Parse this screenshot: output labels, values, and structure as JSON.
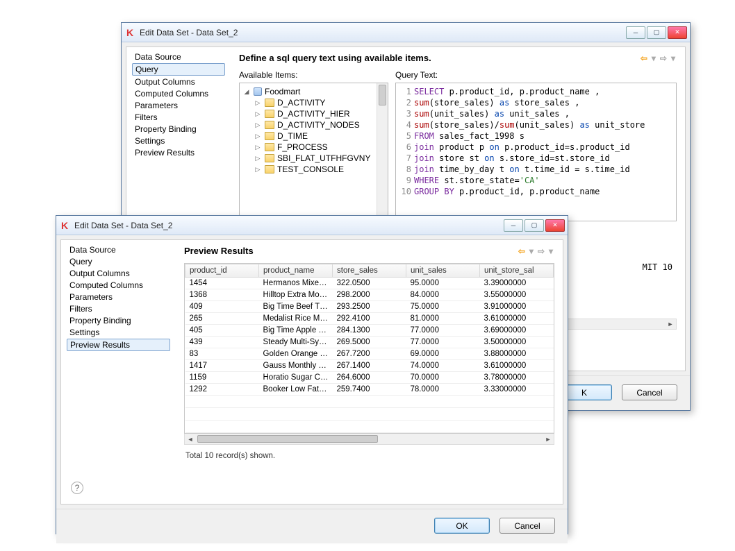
{
  "back": {
    "title": "Edit Data Set - Data Set_2",
    "nav": [
      "Data Source",
      "Query",
      "Output Columns",
      "Computed Columns",
      "Parameters",
      "Filters",
      "Property Binding",
      "Settings",
      "Preview Results"
    ],
    "nav_selected": 1,
    "heading": "Define a sql query text using available items.",
    "available_label": "Available Items:",
    "query_label": "Query Text:",
    "tree_root": "Foodmart",
    "tree_items": [
      "D_ACTIVITY",
      "D_ACTIVITY_HIER",
      "D_ACTIVITY_NODES",
      "D_TIME",
      "F_PROCESS",
      "SBI_FLAT_UTFHFGVNY",
      "TEST_CONSOLE"
    ],
    "sql_lines": [
      {
        "n": 1,
        "tokens": [
          [
            "kw-purple",
            "SELECT"
          ],
          [
            "",
            " p.product_id, p.product_name ,"
          ]
        ]
      },
      {
        "n": 2,
        "tokens": [
          [
            "kw-red",
            "sum"
          ],
          [
            "",
            "(store_sales) "
          ],
          [
            "kw-blue",
            "as"
          ],
          [
            "",
            " store_sales ,"
          ]
        ]
      },
      {
        "n": 3,
        "tokens": [
          [
            "kw-red",
            "sum"
          ],
          [
            "",
            "(unit_sales) "
          ],
          [
            "kw-blue",
            "as"
          ],
          [
            "",
            " unit_sales ,"
          ]
        ]
      },
      {
        "n": 4,
        "tokens": [
          [
            "kw-red",
            "sum"
          ],
          [
            "",
            "(store_sales)/"
          ],
          [
            "kw-red",
            "sum"
          ],
          [
            "",
            "(unit_sales) "
          ],
          [
            "kw-blue",
            "as"
          ],
          [
            "",
            " unit_store"
          ]
        ]
      },
      {
        "n": 5,
        "tokens": [
          [
            "kw-purple",
            "FROM"
          ],
          [
            "",
            " sales_fact_1998 s"
          ]
        ]
      },
      {
        "n": 6,
        "tokens": [
          [
            "kw-purple",
            "join"
          ],
          [
            "",
            " product p "
          ],
          [
            "kw-blue",
            "on"
          ],
          [
            "",
            " p.product_id=s.product_id"
          ]
        ]
      },
      {
        "n": 7,
        "tokens": [
          [
            "kw-purple",
            "join"
          ],
          [
            "",
            " store st "
          ],
          [
            "kw-blue",
            "on"
          ],
          [
            "",
            " s.store_id=st.store_id"
          ]
        ]
      },
      {
        "n": 8,
        "tokens": [
          [
            "kw-purple",
            "join"
          ],
          [
            "",
            " time_by_day t "
          ],
          [
            "kw-blue",
            "on"
          ],
          [
            "",
            " t.time_id = s.time_id"
          ]
        ]
      },
      {
        "n": 9,
        "tokens": [
          [
            "kw-purple",
            "WHERE"
          ],
          [
            "",
            " st.store_state="
          ],
          [
            "kw-green",
            "'CA'"
          ]
        ]
      },
      {
        "n": 10,
        "tokens": [
          [
            "kw-purple",
            "GROUP BY"
          ],
          [
            "",
            " p.product_id, p.product_name"
          ]
        ]
      }
    ],
    "sql_overflow": "MIT 10",
    "ok_fragment": "K",
    "cancel": "Cancel"
  },
  "front": {
    "title": "Edit Data Set - Data Set_2",
    "nav": [
      "Data Source",
      "Query",
      "Output Columns",
      "Computed Columns",
      "Parameters",
      "Filters",
      "Property Binding",
      "Settings",
      "Preview Results"
    ],
    "nav_selected": 8,
    "heading": "Preview Results",
    "columns": [
      "product_id",
      "product_name",
      "store_sales",
      "unit_sales",
      "unit_store_sal"
    ],
    "rows": [
      [
        "1454",
        "Hermanos Mixed ...",
        "322.0500",
        "95.0000",
        "3.39000000"
      ],
      [
        "1368",
        "Hilltop Extra Moist...",
        "298.2000",
        "84.0000",
        "3.55000000"
      ],
      [
        "409",
        "Big Time Beef TV ...",
        "293.2500",
        "75.0000",
        "3.91000000"
      ],
      [
        "265",
        "Medalist Rice Medly",
        "292.4100",
        "81.0000",
        "3.61000000"
      ],
      [
        "405",
        "Big Time Apple Ci...",
        "284.1300",
        "77.0000",
        "3.69000000"
      ],
      [
        "439",
        "Steady Multi-Sym...",
        "269.5000",
        "77.0000",
        "3.50000000"
      ],
      [
        "83",
        "Golden Orange Po...",
        "267.7200",
        "69.0000",
        "3.88000000"
      ],
      [
        "1417",
        "Gauss Monthly Co...",
        "267.1400",
        "74.0000",
        "3.61000000"
      ],
      [
        "1159",
        "Horatio Sugar Co...",
        "264.6000",
        "70.0000",
        "3.78000000"
      ],
      [
        "1292",
        "Booker Low Fat C...",
        "259.7400",
        "78.0000",
        "3.33000000"
      ]
    ],
    "summary": "Total 10 record(s) shown.",
    "ok": "OK",
    "cancel": "Cancel",
    "help": "?"
  }
}
